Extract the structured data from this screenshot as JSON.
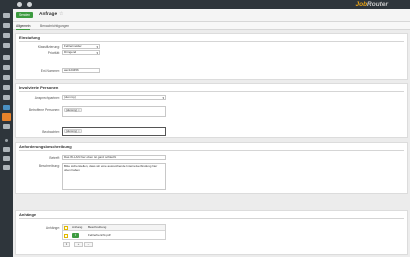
{
  "brand": {
    "name_part1": "Job",
    "name_part2": "Router",
    "color": "#e8a317"
  },
  "topbar": {
    "icons": [
      "home-icon",
      "logout-icon"
    ]
  },
  "header": {
    "send_label": "Senden",
    "form_title": "Anfrage",
    "favorite_icon": "star-icon"
  },
  "tabs": [
    {
      "label": "Allgemein"
    },
    {
      "label": "Benachrichtigungen"
    }
  ],
  "einstufung": {
    "title": "Einstufung",
    "klassifizierung_label": "Klassifizierung:",
    "klassifizierung_value": "Fehlermelder",
    "prioritaet_label": "Priorität:",
    "prioritaet_value": "Dringend",
    "ext_nummer_label": "Ext.Nummer:",
    "ext_nummer_value": "asc123456"
  },
  "personen": {
    "title": "Involvierte Personen",
    "ansprechpartner_label": "Ansprechpartner:",
    "ansprechpartner_value": "(dummy)",
    "betroffene_label": "Betroffene Personen:",
    "betroffene_chip": "(dummy)",
    "beobachter_label": "Beobachter:",
    "beobachter_chip": "(dummy)"
  },
  "beschreibung": {
    "title": "Anforderungsbeschreibung",
    "betreff_label": "Betreff:",
    "betreff_value": "Das W-LAN hier oben ist ganz schlecht",
    "beschreibung_label": "Beschreibung:",
    "beschreibung_value": "Bitte sicherstellen, dass wir eine ausreichende Internetverbindung hier oben haben"
  },
  "anhaenge": {
    "title": "Anhänge",
    "label": "Anhänge:",
    "columns": [
      "Anhang",
      "Beschreibung"
    ],
    "rows": [
      {
        "attachment_button": "⇧",
        "description": "Fehlerbericht.pdf"
      }
    ],
    "pager": {
      "page": "1",
      "add": "+",
      "remove": "−"
    }
  },
  "colors": {
    "accent_green": "#3c9a3f",
    "sidebar_bg": "#2e353b",
    "active_orange": "#e8822a"
  }
}
